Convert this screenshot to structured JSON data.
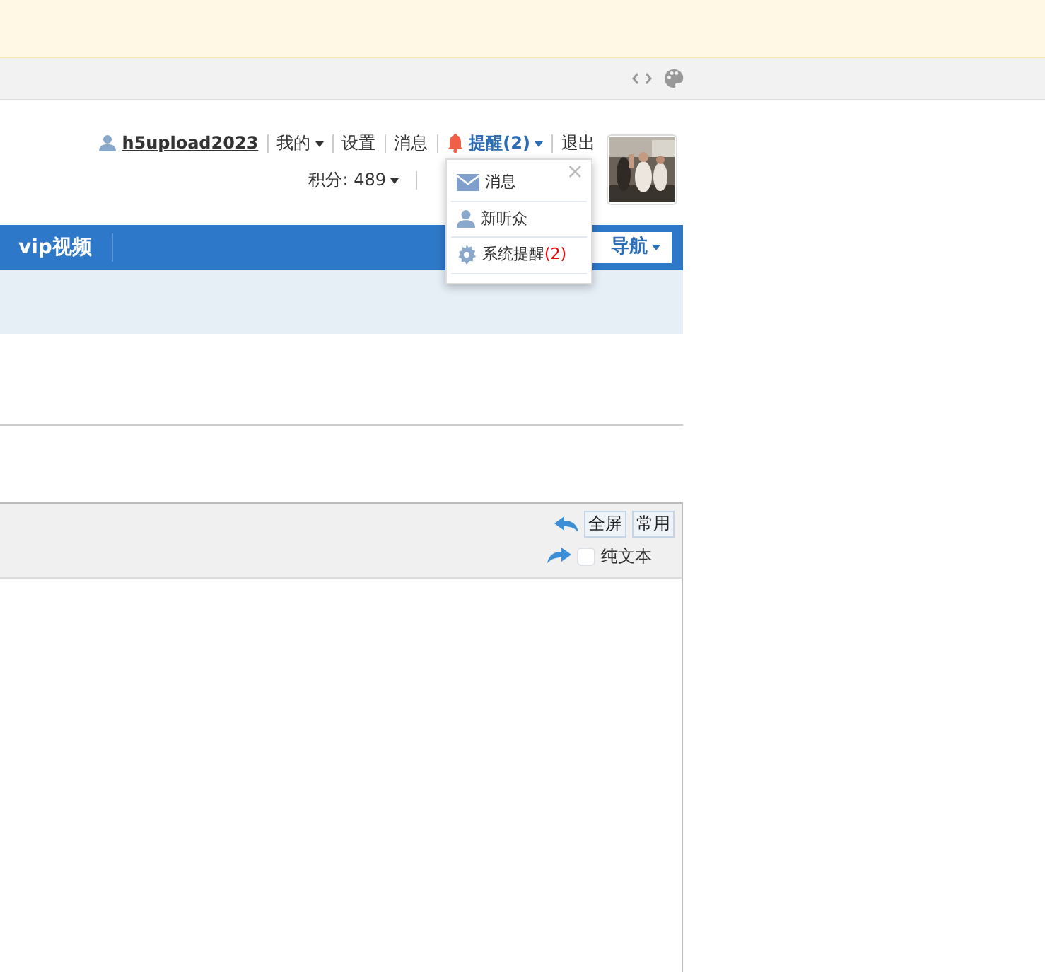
{
  "user_bar": {
    "username": "h5upload2023",
    "links": [
      {
        "label": "我的",
        "caret": true
      },
      {
        "label": "设置",
        "caret": false
      },
      {
        "label": "消息",
        "caret": false
      },
      {
        "label": "提醒(2)",
        "caret": true,
        "kind": "alert"
      },
      {
        "label": "退出",
        "caret": false
      }
    ],
    "points": "积分: 489"
  },
  "notify_menu": {
    "close": "×",
    "items": [
      {
        "label": "消息",
        "kind": "mail"
      },
      {
        "label": "新听众",
        "kind": "user"
      },
      {
        "label": "系统提醒",
        "count": "(2)",
        "kind": "gear"
      }
    ]
  },
  "nav": {
    "items": [
      "vip视频"
    ],
    "right_menu": "导航"
  },
  "editor": {
    "buttons": [
      "全屏",
      "常用"
    ],
    "plain_text": {
      "label": "纯文本",
      "checked": false
    }
  }
}
